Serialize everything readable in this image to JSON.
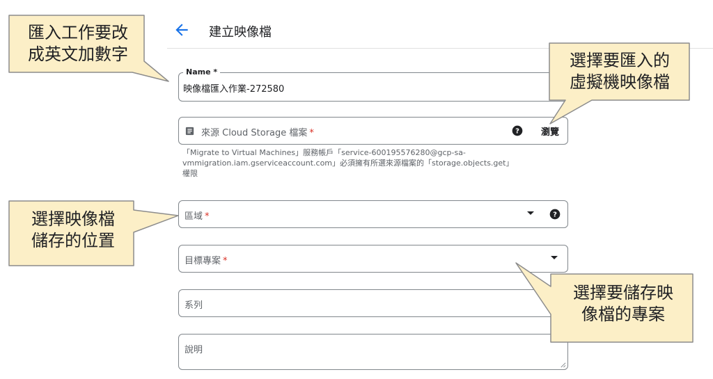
{
  "header": {
    "back_icon": "arrow-back-icon",
    "title": "建立映像檔"
  },
  "form": {
    "name": {
      "label": "Name *",
      "value": "映像檔匯入作業-272580"
    },
    "source": {
      "icon": "document-icon",
      "placeholder": "來源 Cloud Storage 檔案",
      "required_mark": "*",
      "help_icon": "help-icon",
      "browse_label": "瀏覽",
      "hint_line1": "「Migrate to Virtual Machines」服務帳戶「service-600195576280@gcp-sa-",
      "hint_line2": "vmmigration.iam.gserviceaccount.com」必須擁有所選來源檔案的「storage.objects.get」",
      "hint_line3": "權限"
    },
    "region": {
      "label": "區域",
      "required_mark": "*"
    },
    "target_project": {
      "label": "目標專案",
      "required_mark": "*"
    },
    "family": {
      "label": "系列"
    },
    "description": {
      "label": "說明"
    }
  },
  "annotations": {
    "top_left": {
      "line1": "匯入工作要改",
      "line2": "成英文加數字"
    },
    "top_right": {
      "line1": "選擇要匯入的",
      "line2": "虛擬機映像檔"
    },
    "mid_left": {
      "line1": "選擇映像檔",
      "line2": "儲存的位置"
    },
    "bottom_right": {
      "line1": "選擇要儲存映",
      "line2": "像檔的專案"
    }
  },
  "colors": {
    "accent": "#1a73e8",
    "required": "#d93025",
    "callout_fill": "#fcefc7",
    "callout_border": "#8c8c8c"
  }
}
